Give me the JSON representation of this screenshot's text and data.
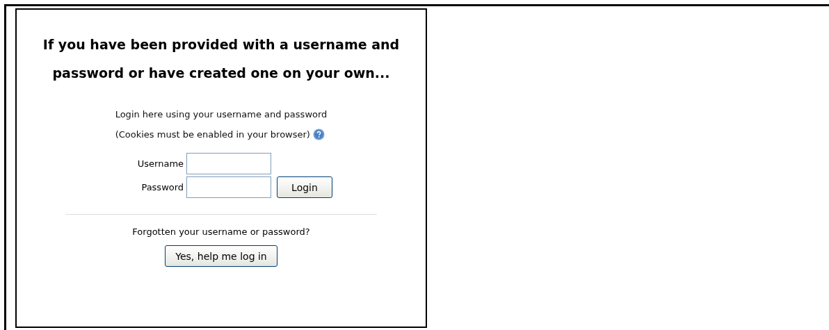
{
  "heading": "If you have been provided with a username and password or have created one on your own...",
  "intro": [
    "Login here using your username and password",
    "(Cookies must be enabled in your browser)"
  ],
  "fields": [
    {
      "label": "Username"
    },
    {
      "label": "Password"
    }
  ],
  "login_button": "Login",
  "forgot_text": "Forgotten your username or password?",
  "help_button": "Yes, help me log in"
}
